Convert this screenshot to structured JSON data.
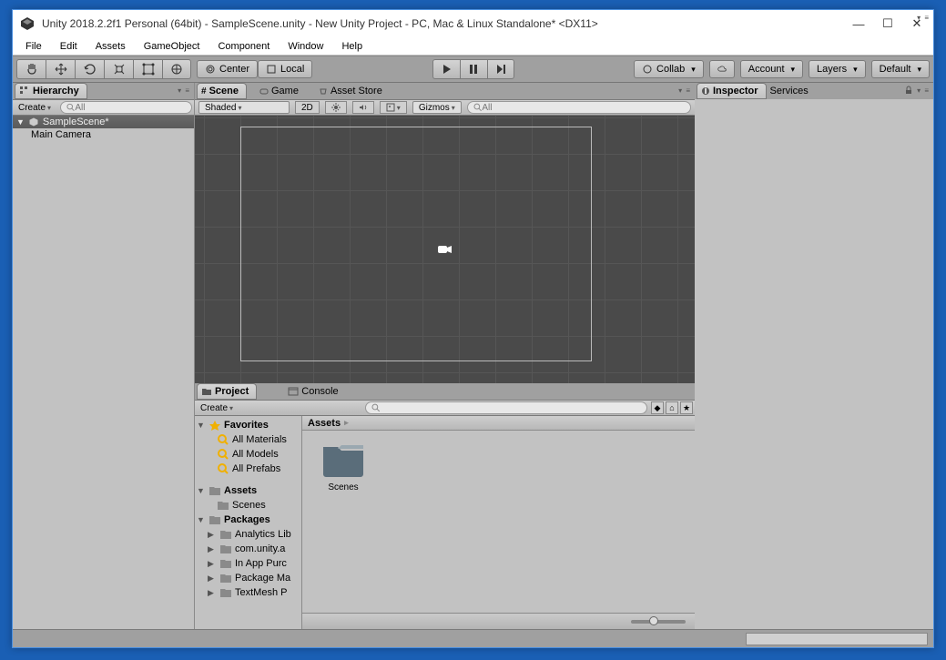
{
  "window": {
    "title": "Unity 2018.2.2f1 Personal (64bit) - SampleScene.unity - New Unity Project - PC, Mac & Linux Standalone* <DX11>"
  },
  "menu": {
    "file": "File",
    "edit": "Edit",
    "assets": "Assets",
    "gameobject": "GameObject",
    "component": "Component",
    "window": "Window",
    "help": "Help"
  },
  "toolbar": {
    "center": "Center",
    "local": "Local",
    "collab": "Collab",
    "account": "Account",
    "layers": "Layers",
    "layout": "Default"
  },
  "hierarchy": {
    "tab": "Hierarchy",
    "create": "Create",
    "search_placeholder": "All",
    "scene": "SampleScene*",
    "items": [
      "Main Camera"
    ]
  },
  "scene": {
    "tab_scene": "Scene",
    "tab_game": "Game",
    "tab_assetstore": "Asset Store",
    "shaded": "Shaded",
    "mode2d": "2D",
    "gizmos": "Gizmos",
    "search_placeholder": "All"
  },
  "inspector": {
    "tab_inspector": "Inspector",
    "tab_services": "Services"
  },
  "project": {
    "tab_project": "Project",
    "tab_console": "Console",
    "create": "Create",
    "search_placeholder": "",
    "breadcrumb": "Assets",
    "folders": [
      {
        "name": "Scenes"
      }
    ],
    "left": {
      "favorites": "Favorites",
      "fav_items": [
        "All Materials",
        "All Models",
        "All Prefabs"
      ],
      "assets": "Assets",
      "asset_items": [
        "Scenes"
      ],
      "packages": "Packages",
      "package_items": [
        "Analytics Lib",
        "com.unity.a",
        "In App Purc",
        "Package Ma",
        "TextMesh P"
      ]
    }
  }
}
